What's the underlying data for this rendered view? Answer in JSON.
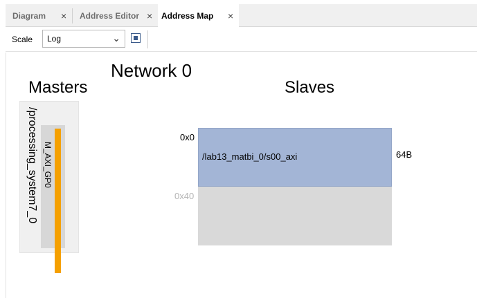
{
  "tabs": [
    {
      "label": "Diagram",
      "close": "×",
      "active": false
    },
    {
      "label": "Address Editor",
      "close": "×",
      "active": false
    },
    {
      "label": "Address Map",
      "close": "×",
      "active": true
    }
  ],
  "toolbar": {
    "scale_label": "Scale",
    "scale_value": "Log",
    "fit_icon": "fit-view-icon"
  },
  "map": {
    "network_title": "Network 0",
    "masters_title": "Masters",
    "slaves_title": "Slaves",
    "master": {
      "name": "/processing_system7_0",
      "port": "M_AXI_GP0",
      "port_color": "#f5a000"
    },
    "segments": [
      {
        "start": "0x0",
        "label": "/lab13_matbi_0/s00_axi",
        "size": "64B",
        "color": "#a3b5d6"
      },
      {
        "start": "0x40",
        "color": "#d9d9d9"
      }
    ]
  }
}
